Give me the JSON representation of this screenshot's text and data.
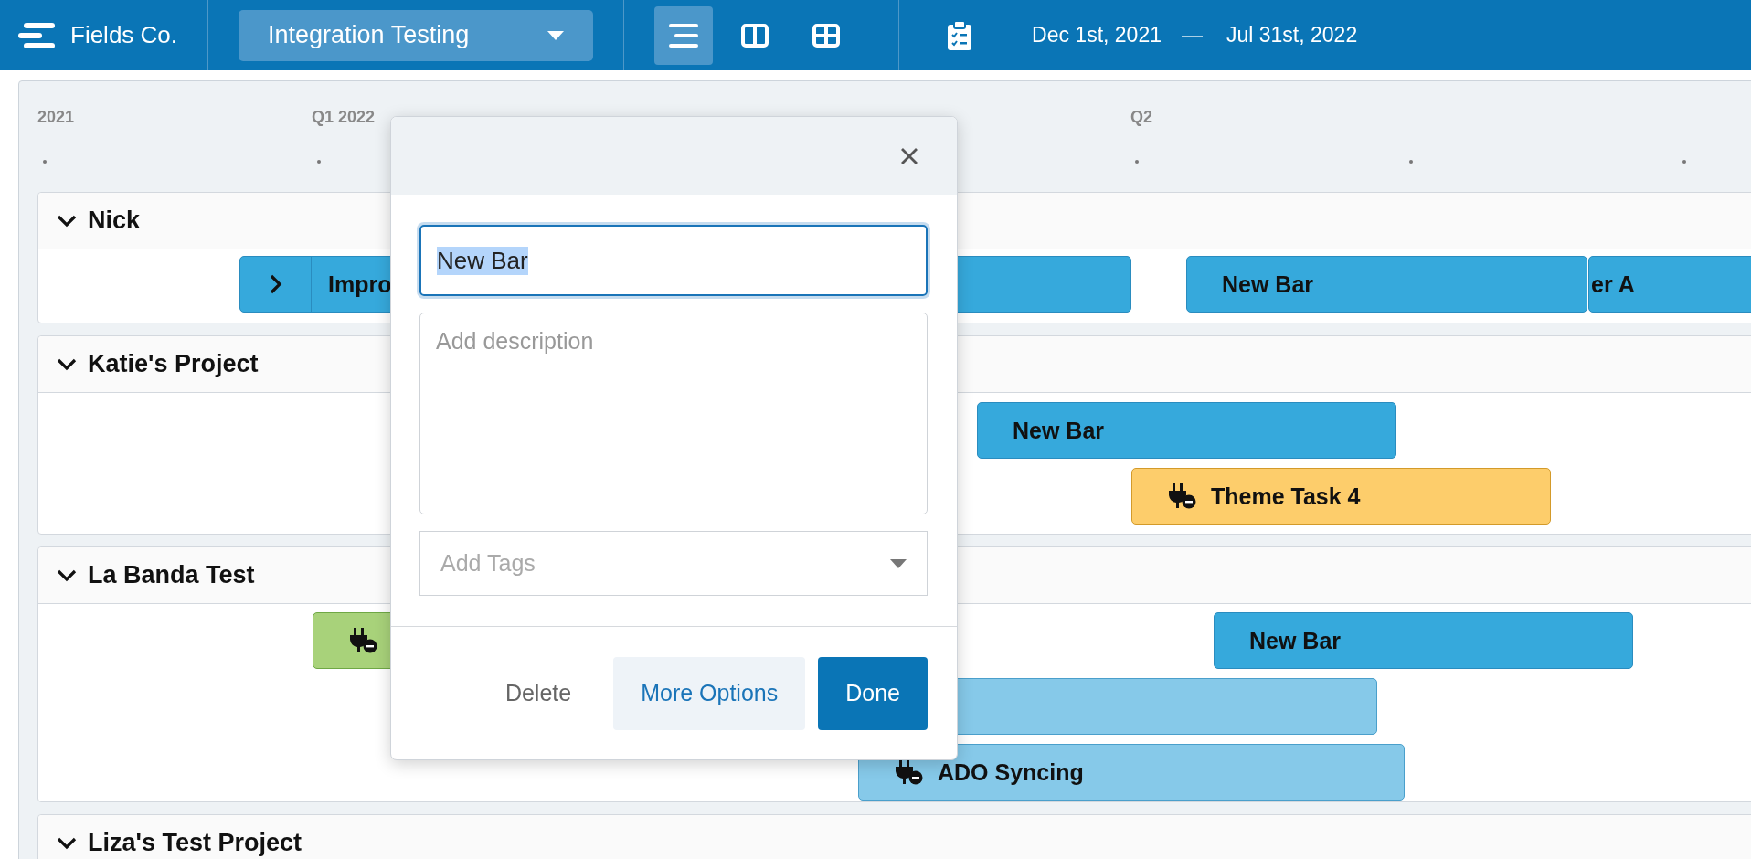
{
  "header": {
    "brand": "Fields Co.",
    "project_selector": "Integration Testing",
    "views": [
      {
        "kind": "list",
        "selected": true
      },
      {
        "kind": "columns",
        "selected": false
      },
      {
        "kind": "grid",
        "selected": false
      }
    ],
    "date_start": "Dec 1st, 2021",
    "date_separator": "—",
    "date_end": "Jul 31st, 2022"
  },
  "timeline": {
    "labels": [
      "2021",
      "Q1 2022",
      "Q2"
    ],
    "groups": [
      {
        "name": "Nick",
        "expanded": true,
        "bars": [
          {
            "label": "Impro",
            "color": "#36a9dc",
            "toggle": true,
            "plugin": false
          },
          {
            "label": "New Bar",
            "color": "#36a9dc",
            "toggle": false,
            "plugin": false
          },
          {
            "label": "er A",
            "color": "#36a9dc",
            "toggle": false,
            "plugin": false
          }
        ]
      },
      {
        "name": "Katie's Project",
        "expanded": true,
        "bars": [
          {
            "label": "New Bar",
            "color": "#36a9dc",
            "toggle": false,
            "plugin": false
          },
          {
            "label": "Theme Task 4",
            "color": "#fdcd6b",
            "toggle": false,
            "plugin": true
          }
        ]
      },
      {
        "name": "La Banda Test",
        "expanded": true,
        "bars": [
          {
            "color": "#a8d27a",
            "toggle": false,
            "plugin": true
          },
          {
            "label": "New Bar",
            "color": "#36a9dc",
            "toggle": false,
            "plugin": false
          },
          {
            "color": "#86c9e9"
          },
          {
            "label": "ADO Syncing",
            "color": "#86c9e9",
            "toggle": false,
            "plugin": true
          }
        ]
      },
      {
        "name": "Liza's Test Project",
        "expanded": true
      }
    ]
  },
  "dialog": {
    "name_value": "New Bar",
    "name_selected": true,
    "description_placeholder": "Add description",
    "tags_placeholder": "Add Tags",
    "buttons": [
      {
        "label": "Delete",
        "kind": "text"
      },
      {
        "label": "More Options",
        "kind": "secondary"
      },
      {
        "label": "Done",
        "kind": "primary"
      }
    ]
  }
}
